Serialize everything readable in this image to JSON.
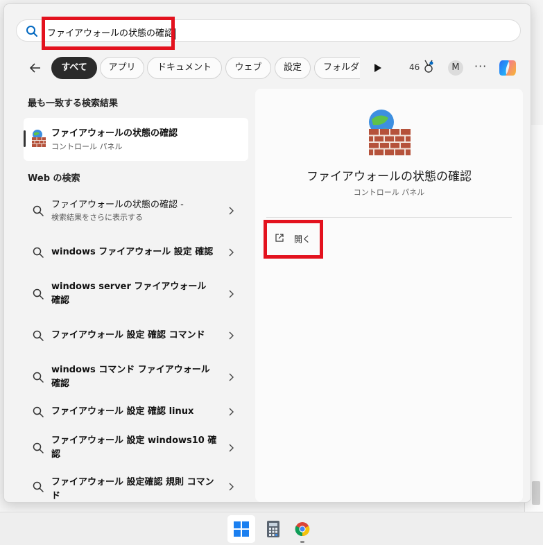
{
  "search": {
    "query": "ファイアウォールの状態の確認"
  },
  "filters": {
    "tabs": [
      {
        "label": "すべて",
        "active": true
      },
      {
        "label": "アプリ",
        "active": false
      },
      {
        "label": "ドキュメント",
        "active": false
      },
      {
        "label": "ウェブ",
        "active": false
      },
      {
        "label": "設定",
        "active": false
      },
      {
        "label": "フォルダー",
        "active": false
      }
    ],
    "points": "46",
    "avatar_initial": "M",
    "more_options": "···"
  },
  "best_match": {
    "heading": "最も一致する検索結果",
    "title": "ファイアウォールの状態の確認",
    "subtitle": "コントロール パネル"
  },
  "web_search": {
    "heading": "Web の検索",
    "items": [
      {
        "text": "ファイアウォールの状態の確認 -",
        "sub": "検索結果をさらに表示する"
      },
      {
        "text": "windows ファイアウォール 設定 確認"
      },
      {
        "text": "windows server ファイアウォール 確認"
      },
      {
        "text": "ファイアウォール 設定 確認 コマンド"
      },
      {
        "text": "windows コマンド ファイアウォール 確認"
      },
      {
        "text": "ファイアウォール 設定 確認 linux"
      },
      {
        "text": "ファイアウォール 設定 windows10 確認"
      },
      {
        "text": "ファイアウォール 設定確認 規則 コマンド"
      }
    ]
  },
  "detail": {
    "title": "ファイアウォールの状態の確認",
    "subtitle": "コントロール パネル",
    "open_label": "開く"
  },
  "colors": {
    "highlight": "#e3121e",
    "accent": "#0067c0"
  }
}
